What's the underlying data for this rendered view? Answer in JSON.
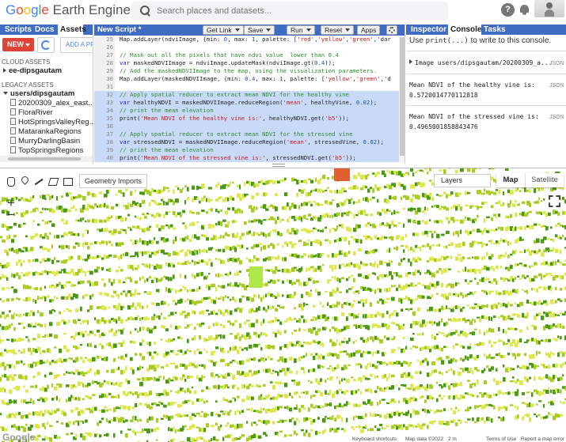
{
  "logo": {
    "google": "Google",
    "product": "Earth Engine"
  },
  "search": {
    "placeholder": "Search places and datasets..."
  },
  "left_panel": {
    "tabs": [
      "Scripts",
      "Docs",
      "Assets"
    ],
    "active_tab": "Assets",
    "new_label": "NEW",
    "add_project_label": "ADD A PR",
    "cloud_assets_label": "CLOUD ASSETS",
    "cloud_project": "ee-dipsgautam",
    "legacy_assets_label": "LEGACY ASSETS",
    "legacy_root": "users/dipsgautam",
    "assets": [
      "20200309_alex_east...",
      "FloraRiver",
      "HotSpringsValleyReg...",
      "MatarankaRegions",
      "MurryDarlingBasin",
      "TopSpringsRegions"
    ]
  },
  "editor": {
    "title": "New Script *",
    "buttons": {
      "get_link": "Get Link",
      "save": "Save",
      "run": "Run",
      "reset": "Reset",
      "apps": "Apps"
    },
    "lines": [
      {
        "n": "25",
        "text": "Map.addLayer(ndviImage, {min: 0, max: 1, palette: ['red','yellow','green','dar"
      },
      {
        "n": "26",
        "text": ""
      },
      {
        "n": "27",
        "text": "// Mask out all the pixels that have ndvi value  lower than 0.4"
      },
      {
        "n": "28",
        "text": "var maskedNDVIImage = ndviImage.updateMask(ndviImage.gt(0.4));"
      },
      {
        "n": "29",
        "text": "// Add the maskedNDVIImage to the map, using the visualization parameters."
      },
      {
        "n": "30",
        "text": "Map.addLayer(maskedNDVIImage, {min: 0.4, max: 1, palette: ['yellow','green','d"
      },
      {
        "n": "31",
        "text": ""
      },
      {
        "n": "32",
        "text": "// Apply spatial reducer to extract mean NDVI for the healthy vine"
      },
      {
        "n": "33",
        "text": "var healthyNDVI = maskedNDVIImage.reduceRegion('mean', healthyVine, 0.02);"
      },
      {
        "n": "34",
        "text": "// print the mean elevation"
      },
      {
        "n": "35",
        "text": "print('Mean NDVI of the healthy vine is:', healthyNDVI.get('b5'));"
      },
      {
        "n": "36",
        "text": ""
      },
      {
        "n": "37",
        "text": "// Apply spatial reducer to extract mean NDVI for the stressed vine"
      },
      {
        "n": "38",
        "text": "var stressedNDVI = maskedNDVIImage.reduceRegion('mean', stressedVine, 0.02);"
      },
      {
        "n": "39",
        "text": "// print the mean elevation"
      },
      {
        "n": "40",
        "text": "print('Mean NDVI of the stressed vine is:', stressedNDVI.get('b5'));"
      }
    ]
  },
  "right_panel": {
    "tabs": [
      "Inspector",
      "Console",
      "Tasks"
    ],
    "active_tab": "Console",
    "hint_prefix": "Use ",
    "hint_code": "print(...)",
    "hint_suffix": " to write to this console.",
    "json_tag": "JSON",
    "entries": [
      {
        "line1": "Image users/dipsgautam/20200309_a...",
        "line2": ""
      },
      {
        "line1": "Mean NDVI of the healthy vine is:",
        "line2": "0.5720014770112818"
      },
      {
        "line1": "Mean NDVI of the stressed vine is:",
        "line2": "0.4965001858843476"
      }
    ]
  },
  "map": {
    "geometry_imports": "Geometry Imports",
    "layers": "Layers",
    "map_type_map": "Map",
    "map_type_satellite": "Satellite",
    "zoom_in": "+",
    "zoom_out": "−",
    "watermark": "Google",
    "attribution": {
      "shortcuts": "Keyboard shortcuts",
      "data": "Map data ©2022",
      "scale": "2 m",
      "terms": "Terms of Use",
      "report": "Report a map error"
    },
    "colors": {
      "light": "#dce84a",
      "mid": "#a8cc22",
      "dark": "#4a9a12",
      "marker_healthy": "#aee84a",
      "marker_top": "#e06030"
    }
  }
}
